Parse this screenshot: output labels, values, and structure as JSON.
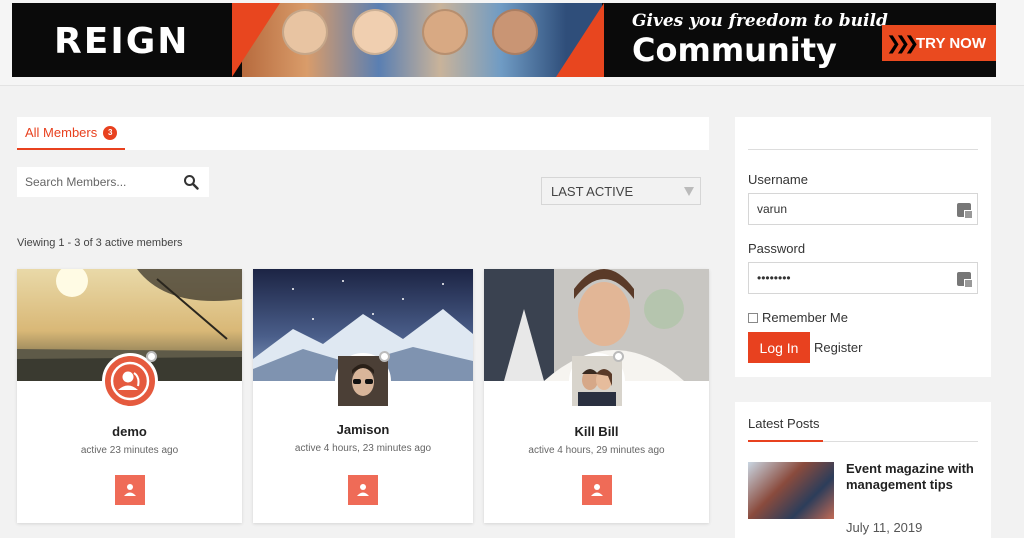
{
  "banner": {
    "logo": "REIGN",
    "tagline_small": "Gives you freedom to build",
    "tagline_big": "Community",
    "cta_label": "TRY NOW",
    "cta_arrows": "❯❯❯"
  },
  "tabs": [
    {
      "label": "All Members",
      "count": "3"
    }
  ],
  "search": {
    "placeholder": "Search Members...",
    "icon": "search-icon"
  },
  "order_select": {
    "value": "LAST ACTIVE"
  },
  "viewing_text": "Viewing 1 - 3 of 3 active members",
  "members": [
    {
      "name": "demo",
      "active": "active 23 minutes ago"
    },
    {
      "name": "Jamison",
      "active": "active 4 hours, 23 minutes ago"
    },
    {
      "name": "Kill Bill",
      "active": "active 4 hours, 29 minutes ago"
    }
  ],
  "login": {
    "username_label": "Username",
    "username_value": "varun",
    "password_label": "Password",
    "password_value": "••••••••",
    "remember_label": "Remember Me",
    "login_button": "Log In",
    "register_link": "Register"
  },
  "latest_posts": {
    "title": "Latest Posts",
    "items": [
      {
        "title": "Event magazine with management tips",
        "date": "July 11, 2019"
      }
    ]
  },
  "colors": {
    "accent": "#e8411f",
    "add_button": "#ef6b57"
  }
}
